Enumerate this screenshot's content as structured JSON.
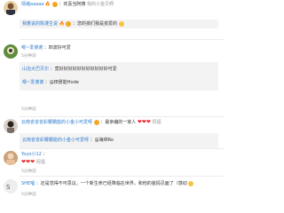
{
  "c1": {
    "user": "情绪aaaaa",
    "text": "：欢喜当阿姨",
    "suffix": "我的小金贝啊"
  },
  "r1": {
    "user": "我着说的陈谨生说",
    "text": "：您的孩们我是孩爱的"
  },
  "c2": {
    "user": "嗯~爱谢谢",
    "text": "：四波好可爱",
    "time": "5分钟前",
    "actions": "回复"
  },
  "r2": {
    "user": "山治大巴贝尔",
    "text": "：竟好好好好好好好好好好好可爱"
  },
  "r3": {
    "user": "嗯~爱谢谢",
    "text": "：@田景能Hode"
  },
  "c3": {
    "user": "云南省省省彩鞭霸能的小金小可爱呀",
    "text": "：最亲编的一家人",
    "suffix": "祝福"
  },
  "r4": {
    "user": "云南省省彩鞭霸能的小金小可爱呀",
    "text": "：@海绵Ro"
  },
  "c4": {
    "user": "Yoyo小12",
    "text": "：",
    "suffix": "祝福"
  },
  "c5": {
    "user": "SHE唱",
    "text": "：还是觉得不可思议，一个新生命已经降临在世界，和他的爸妈见面了（感动"
  },
  "meta_time": "5分钟前",
  "meta_like": "回复",
  "emoji": {
    "heart": "❤",
    "fire": "🔥",
    "smile": "☺"
  }
}
